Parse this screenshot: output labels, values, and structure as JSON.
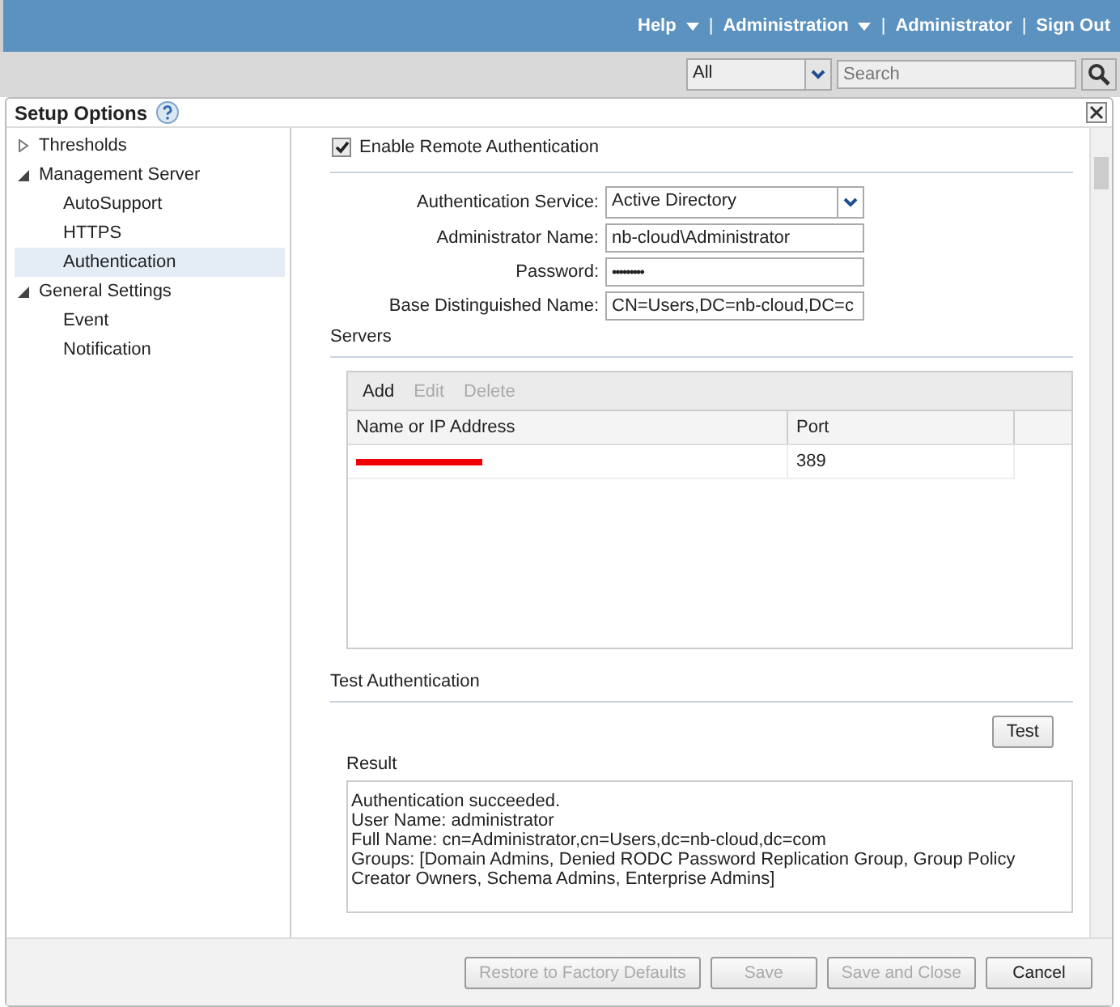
{
  "top_nav": [
    {
      "label": "Help",
      "dropdown": true
    },
    {
      "separator": "|",
      "label": "Administration",
      "dropdown": true
    },
    {
      "separator": "|",
      "label": "Administrator",
      "dropdown": false
    },
    {
      "separator": "|",
      "label": "Sign Out",
      "dropdown": false
    }
  ],
  "search_bar": {
    "scope": "All",
    "placeholder": "Search"
  },
  "dialog": {
    "title": "Setup Options",
    "sidebar": [
      {
        "label": "Thresholds",
        "expanded": false,
        "selected": false
      },
      {
        "label": "Management Server",
        "expanded": true,
        "selected": false,
        "children": [
          {
            "label": "AutoSupport",
            "selected": false
          },
          {
            "label": "HTTPS",
            "selected": false
          },
          {
            "label": "Authentication",
            "selected": true
          }
        ]
      },
      {
        "label": "General Settings",
        "expanded": true,
        "selected": false,
        "children": [
          {
            "label": "Event",
            "selected": false
          },
          {
            "label": "Notification",
            "selected": false
          }
        ]
      }
    ],
    "enable_remote_auth": {
      "label": "Enable Remote Authentication",
      "checked": true
    },
    "form": [
      {
        "kind": "select",
        "label": "Authentication Service:",
        "value": "Active Directory"
      },
      {
        "kind": "text",
        "label": "Administrator Name:",
        "value": "nb-cloud\\Administrator"
      },
      {
        "kind": "password",
        "label": "Password:",
        "value": "•••••••••"
      },
      {
        "kind": "text",
        "label": "Base Distinguished Name:",
        "value": "CN=Users,DC=nb-cloud,DC=c"
      }
    ],
    "servers": {
      "heading": "Servers",
      "toolbar": [
        {
          "label": "Add",
          "disabled": false
        },
        {
          "label": "Edit",
          "disabled": true
        },
        {
          "label": "Delete",
          "disabled": true
        }
      ],
      "columns": [
        "Name or IP Address",
        "Port"
      ],
      "rows": [
        {
          "redacted": true,
          "port": "389"
        }
      ]
    },
    "test": {
      "heading": "Test Authentication",
      "button": "Test",
      "result_label": "Result",
      "result_lines": [
        "Authentication succeeded.",
        "User Name: administrator",
        "Full Name: cn=Administrator,cn=Users,dc=nb-cloud,dc=com",
        "Groups: [Domain Admins, Denied RODC Password Replication Group, Group Policy Creator Owners, Schema Admins, Enterprise Admins]"
      ]
    },
    "footer_buttons": [
      {
        "label": "Restore to Factory Defaults",
        "disabled": true
      },
      {
        "label": "Save",
        "disabled": true
      },
      {
        "label": "Save and Close",
        "disabled": true
      },
      {
        "label": "Cancel",
        "disabled": false
      }
    ]
  }
}
